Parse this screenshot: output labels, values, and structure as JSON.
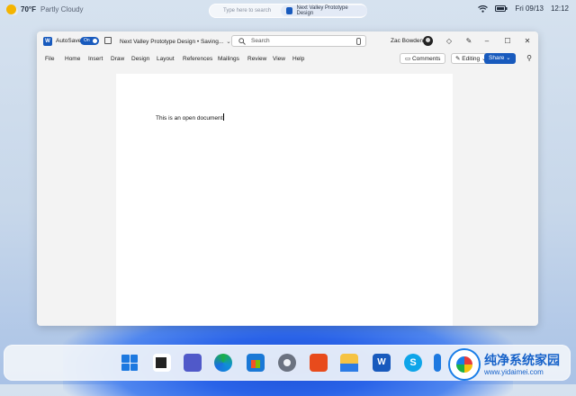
{
  "topbar": {
    "weather_temp": "70°F",
    "weather_cond": "Partly Cloudy",
    "search_placeholder": "Type here to search",
    "active_app": "Next Valley Prototype Design",
    "clock": "Fri 09/13",
    "time": "12:12"
  },
  "window": {
    "autosave_label": "AutoSave",
    "autosave_state": "On",
    "doc_title": "Next Valley Prototype Design • Saving...",
    "search_label": "Search",
    "user_name": "Zac Bowden",
    "menu": [
      "File",
      "Home",
      "Insert",
      "Draw",
      "Design",
      "Layout",
      "References",
      "Mailings",
      "Review",
      "View",
      "Help"
    ],
    "comments_label": "Comments",
    "editing_label": "Editing",
    "share_label": "Share"
  },
  "document": {
    "body_text": "This is an open document"
  },
  "watermark": {
    "brand": "纯净系统家园",
    "url": "www.yidaimei.com"
  },
  "colors": {
    "word_blue": "#185abd",
    "accent": "#1d79e0"
  },
  "taskbar_icons": [
    "start-icon",
    "task-view-icon",
    "teams-icon",
    "edge-icon",
    "store-icon",
    "settings-icon",
    "office-icon",
    "file-explorer-icon",
    "word-icon",
    "skype-icon",
    "unknown-icon"
  ]
}
